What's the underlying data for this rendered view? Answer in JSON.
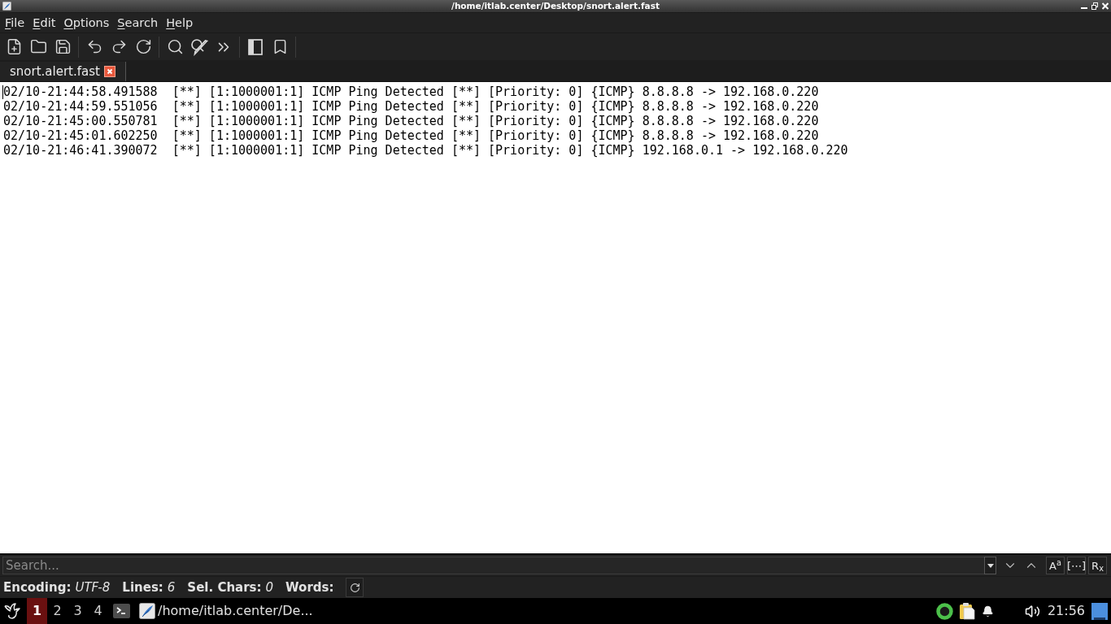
{
  "window": {
    "title": "/home/itlab.center/Desktop/snort.alert.fast"
  },
  "menu": [
    {
      "label": "File"
    },
    {
      "label": "Edit"
    },
    {
      "label": "Options"
    },
    {
      "label": "Search"
    },
    {
      "label": "Help"
    }
  ],
  "tabs": [
    {
      "label": "snort.alert.fast",
      "selected": true
    }
  ],
  "editor": {
    "lines": [
      "02/10-21:44:58.491588  [**] [1:1000001:1] ICMP Ping Detected [**] [Priority: 0] {ICMP} 8.8.8.8 -> 192.168.0.220",
      "02/10-21:44:59.551056  [**] [1:1000001:1] ICMP Ping Detected [**] [Priority: 0] {ICMP} 8.8.8.8 -> 192.168.0.220",
      "02/10-21:45:00.550781  [**] [1:1000001:1] ICMP Ping Detected [**] [Priority: 0] {ICMP} 8.8.8.8 -> 192.168.0.220",
      "02/10-21:45:01.602250  [**] [1:1000001:1] ICMP Ping Detected [**] [Priority: 0] {ICMP} 8.8.8.8 -> 192.168.0.220",
      "02/10-21:46:41.390072  [**] [1:1000001:1] ICMP Ping Detected [**] [Priority: 0] {ICMP} 192.168.0.1 -> 192.168.0.220"
    ]
  },
  "search_bar": {
    "placeholder": "Search...",
    "options": [
      {
        "label": "A$^{a}$"
      },
      {
        "label": "[⋯]"
      },
      {
        "label": "R$_{x}$"
      }
    ]
  },
  "status_bar": [
    {
      "label": "Encoding:",
      "value": "UTF-8"
    },
    {
      "label": "Lines:",
      "value": "6"
    },
    {
      "label": "Sel. Chars:",
      "value": "0"
    },
    {
      "label": "Words:"
    }
  ],
  "taskbar": {
    "workspaces": [
      {
        "label": "1",
        "selected": true
      },
      {
        "label": "2",
        "selected": false
      },
      {
        "label": "3",
        "selected": false
      },
      {
        "label": "4",
        "selected": false
      }
    ],
    "tasks": [
      {
        "label": "/home/itlab.center/De..."
      }
    ],
    "clock": "21:56"
  }
}
